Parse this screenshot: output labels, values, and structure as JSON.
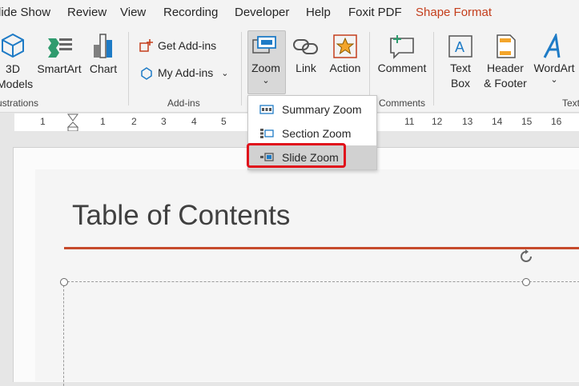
{
  "tabs": [
    {
      "label": "lide Show"
    },
    {
      "label": "Review"
    },
    {
      "label": "View"
    },
    {
      "label": "Recording"
    },
    {
      "label": "Developer"
    },
    {
      "label": "Help"
    },
    {
      "label": "Foxit PDF"
    },
    {
      "label": "Shape Format"
    }
  ],
  "ribbon": {
    "models_l1": "3D",
    "models_l2": "Models",
    "smartart": "SmartArt",
    "chart": "Chart",
    "illustrations_label": "ustrations",
    "get_addins": "Get Add-ins",
    "my_addins": "My Add-ins",
    "addins_label": "Add-ins",
    "zoom": "Zoom",
    "link": "Link",
    "action": "Action",
    "comment": "Comment",
    "comments_label": "Comments",
    "textbox_l1": "Text",
    "textbox_l2": "Box",
    "header_l1": "Header",
    "header_l2": "& Footer",
    "wordart": "WordArt",
    "text_label": "Text"
  },
  "ruler": {
    "numbers": [
      "1",
      "1",
      "2",
      "3",
      "4",
      "5",
      "11",
      "12",
      "13",
      "14",
      "15",
      "16"
    ]
  },
  "zoom_menu": {
    "items": [
      {
        "label": "Summary Zoom"
      },
      {
        "label": "Section Zoom"
      },
      {
        "label": "Slide Zoom"
      }
    ]
  },
  "slide": {
    "title": "Table of Contents"
  },
  "colors": {
    "accent_red": "#c64a2b",
    "highlight_box": "#e0111b",
    "shape_format_tab": "#c43e1c"
  }
}
